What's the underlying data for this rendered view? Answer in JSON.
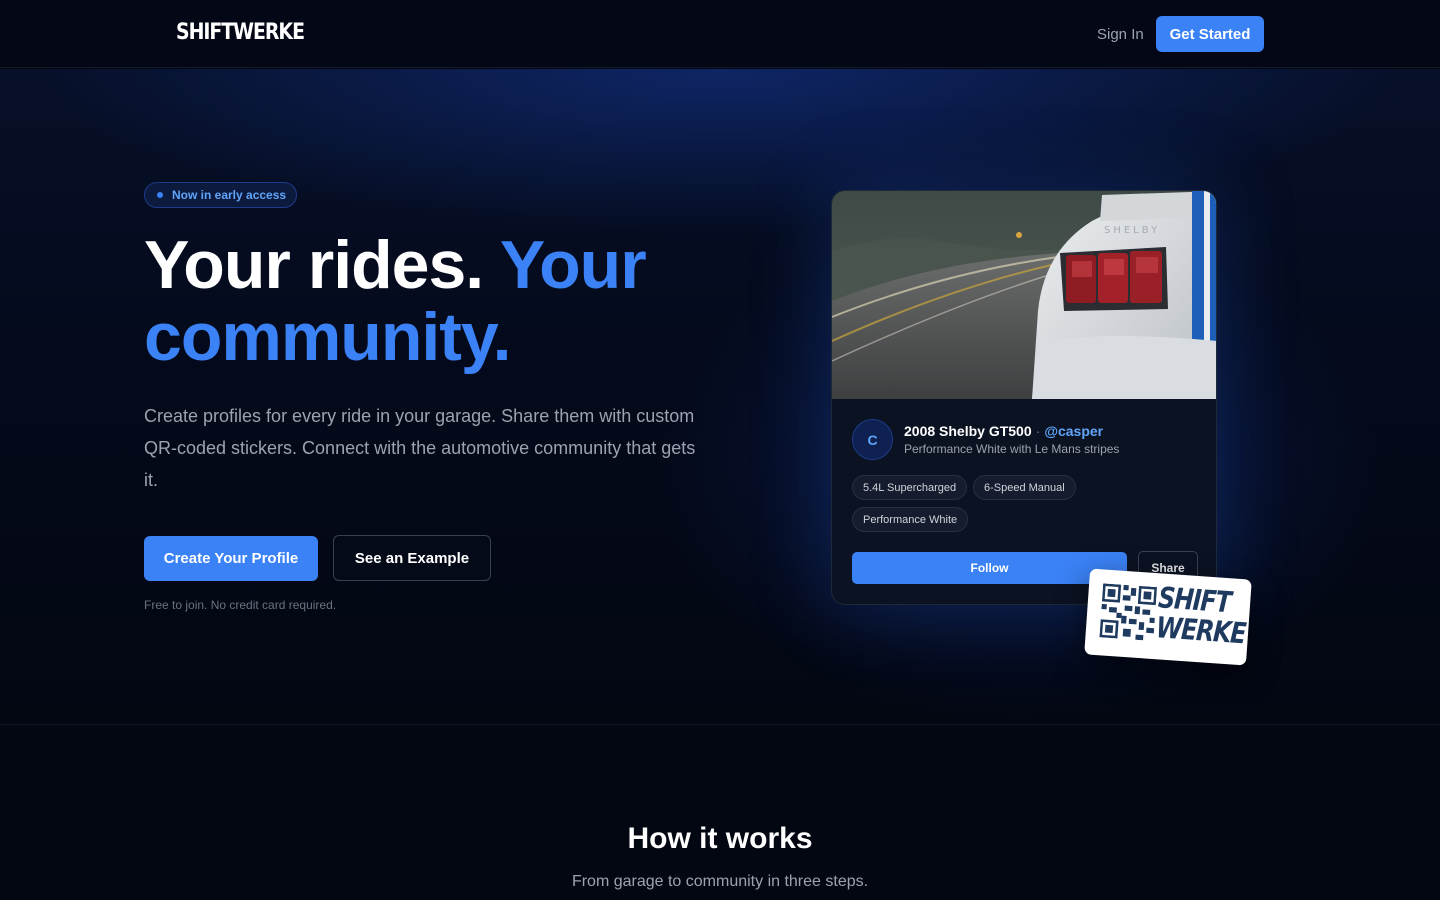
{
  "nav": {
    "logo": "SHIFTWERKE",
    "sign_in": "Sign In",
    "get_started": "Get Started"
  },
  "hero": {
    "badge": "Now in early access",
    "headline_white": "Your rides. ",
    "headline_blue": "Your community.",
    "subtitle": "Create profiles for every ride in your garage. Share them with custom QR-coded stickers. Connect with the automotive community that gets it.",
    "cta_primary": "Create Your Profile",
    "cta_secondary": "See an Example",
    "fineprint": "Free to join. No credit card required."
  },
  "profile_card": {
    "avatar_initial": "C",
    "car_name": "2008 Shelby GT500",
    "separator": "·",
    "handle": "@casper",
    "description": "Performance White with Le Mans stripes",
    "specs": [
      "5.4L Supercharged",
      "6-Speed Manual",
      "Performance White"
    ],
    "follow_label": "Follow",
    "share_label": "Share"
  },
  "sticker": {
    "line1": "SHIFT",
    "line2": "WERKE"
  },
  "how_it_works": {
    "title": "How it works",
    "subtitle": "From garage to community in three steps."
  },
  "colors": {
    "accent": "#3b82f6",
    "background": "#030712",
    "muted_text": "#9ca3af"
  }
}
